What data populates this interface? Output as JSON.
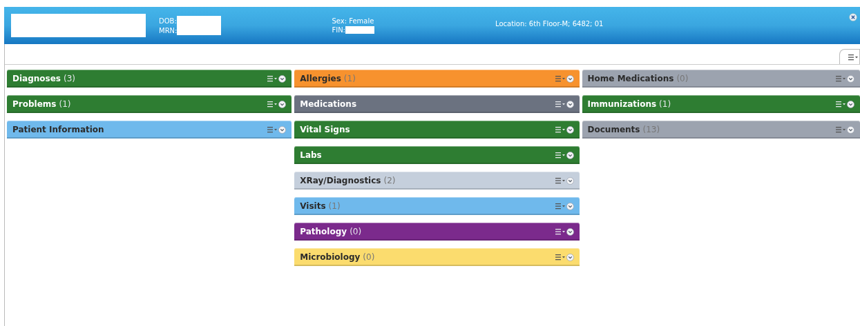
{
  "header": {
    "dob_label": "DOB:",
    "mrn_label": "MRN:",
    "sex": "Sex: Female",
    "fin_label": "FIN:",
    "location": "Location: 6th Floor-M; 6482; 01"
  },
  "columns": [
    {
      "panels": [
        {
          "title": "Diagnoses",
          "count": "(3)",
          "color": "#2e7d32"
        },
        {
          "title": "Problems",
          "count": "(1)",
          "color": "#2e7d32"
        },
        {
          "title": "Patient Information",
          "color": "#6fb9ec"
        }
      ]
    },
    {
      "panels": [
        {
          "title": "Allergies",
          "count": "(1)",
          "color": "#f7922e"
        },
        {
          "title": "Medications",
          "color": "#6b7280"
        },
        {
          "title": "Vital Signs",
          "color": "#2e7d32"
        },
        {
          "title": "Labs",
          "color": "#2e7d32"
        },
        {
          "title": "XRay/Diagnostics",
          "count": "(2)",
          "color": "#c5cfdc"
        },
        {
          "title": "Visits",
          "count": "(1)",
          "color": "#6fb9ec"
        },
        {
          "title": "Pathology",
          "count": "(0)",
          "color": "#7b2a8c"
        },
        {
          "title": "Microbiology",
          "count": "(0)",
          "color": "#fbdc6e"
        }
      ]
    },
    {
      "panels": [
        {
          "title": "Home Medications",
          "count": "(0)",
          "color": "#9ca3af"
        },
        {
          "title": "Immunizations",
          "count": "(1)",
          "color": "#2e7d32"
        },
        {
          "title": "Documents",
          "count": "(13)",
          "color": "#9ca3af"
        }
      ]
    }
  ]
}
